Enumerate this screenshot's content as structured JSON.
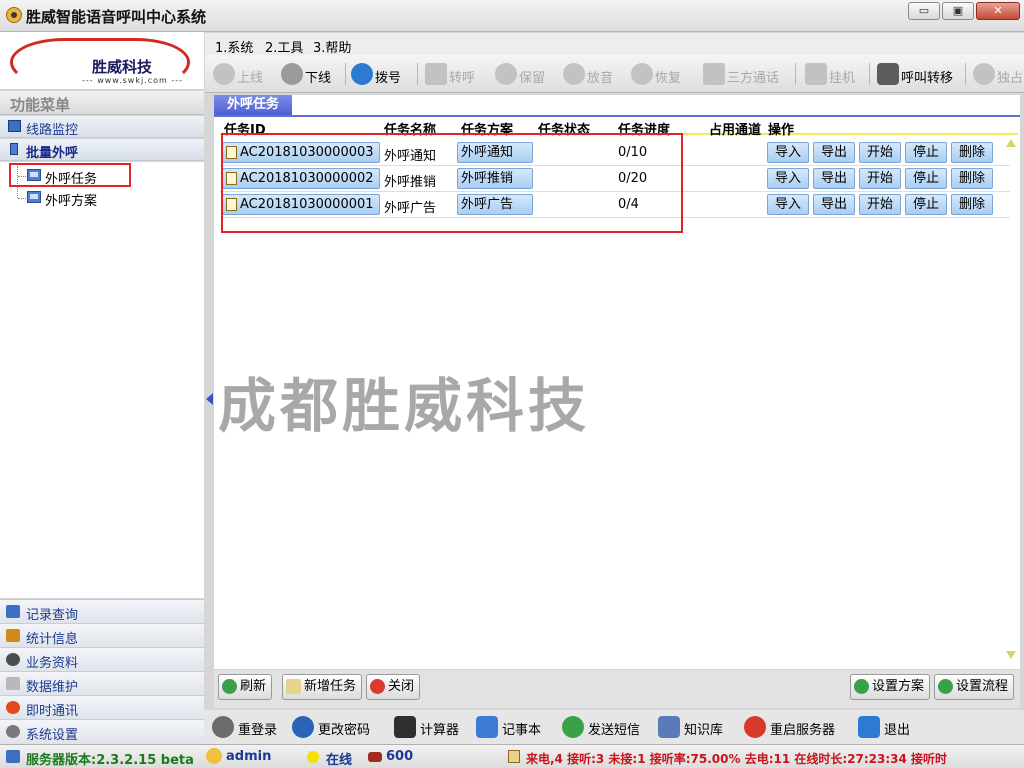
{
  "window": {
    "title": "胜威智能语音呼叫中心系统",
    "minimize": "▭",
    "restore": "▣",
    "close": "✕"
  },
  "logo": {
    "name": "胜威科技",
    "url": "--- www.swkj.com ---"
  },
  "menu": {
    "items": [
      "1.系统",
      "2.工具",
      "3.帮助"
    ]
  },
  "toolbar": {
    "items": [
      {
        "label": "上线",
        "icon": "user-icon",
        "enabled": false
      },
      {
        "label": "下线",
        "icon": "user-icon",
        "enabled": true
      },
      {
        "label": "拨号",
        "icon": "phone-icon",
        "enabled": true
      },
      {
        "label": "转呼",
        "icon": "transfer-icon",
        "enabled": false
      },
      {
        "label": "保留",
        "icon": "hold-icon",
        "enabled": false
      },
      {
        "label": "放音",
        "icon": "play-icon",
        "enabled": false
      },
      {
        "label": "恢复",
        "icon": "resume-icon",
        "enabled": false
      },
      {
        "label": "三方通话",
        "icon": "conference-icon",
        "enabled": false
      },
      {
        "label": "挂机",
        "icon": "hangup-icon",
        "enabled": false
      },
      {
        "label": "呼叫转移",
        "icon": "forward-icon",
        "enabled": true
      },
      {
        "label": "独占",
        "icon": "exclusive-icon",
        "enabled": false
      }
    ]
  },
  "sidebar": {
    "header": "功能菜单",
    "top_items": [
      {
        "label": "线路监控",
        "icon": "monitor-icon"
      },
      {
        "label": "批量外呼",
        "icon": "batch-call-icon"
      }
    ],
    "tree": [
      {
        "label": "外呼任务"
      },
      {
        "label": "外呼方案"
      }
    ],
    "bottom_items": [
      {
        "label": "记录查询",
        "icon": "records-icon",
        "color": "#3a6fc4"
      },
      {
        "label": "统计信息",
        "icon": "stats-icon",
        "color": "#d08a18"
      },
      {
        "label": "业务资料",
        "icon": "business-icon",
        "color": "#4c4c4c"
      },
      {
        "label": "数据维护",
        "icon": "data-icon",
        "color": "#8a8a8a"
      },
      {
        "label": "即时通讯",
        "icon": "im-icon",
        "color": "#e04b1b"
      },
      {
        "label": "系统设置",
        "icon": "settings-icon",
        "color": "#7a7a7a"
      }
    ]
  },
  "tab": {
    "label": "外呼任务"
  },
  "table": {
    "headers": [
      "任务ID",
      "任务名称",
      "任务方案",
      "任务状态",
      "任务进度",
      "占用通道",
      "操作"
    ],
    "rows": [
      {
        "id": "AC20181030000003",
        "name": "外呼通知",
        "plan": "外呼通知",
        "status": "",
        "progress": "0/10",
        "channels": ""
      },
      {
        "id": "AC20181030000002",
        "name": "外呼推销",
        "plan": "外呼推销",
        "status": "",
        "progress": "0/20",
        "channels": ""
      },
      {
        "id": "AC20181030000001",
        "name": "外呼广告",
        "plan": "外呼广告",
        "status": "",
        "progress": "0/4",
        "channels": ""
      }
    ],
    "row_actions": [
      "导入",
      "导出",
      "开始",
      "停止",
      "删除"
    ]
  },
  "watermark": "成都胜威科技",
  "actions": {
    "refresh": "刷新",
    "new_task": "新增任务",
    "close": "关闭",
    "set_plan": "设置方案",
    "set_flow": "设置流程"
  },
  "tools": [
    {
      "label": "重登录",
      "icon": "relogin-icon",
      "color": "#6b6b6b"
    },
    {
      "label": "更改密码",
      "icon": "password-icon",
      "color": "#2a63b8"
    },
    {
      "label": "计算器",
      "icon": "calculator-icon",
      "color": "#2f2f2f"
    },
    {
      "label": "记事本",
      "icon": "notepad-icon",
      "color": "#3d7bd4"
    },
    {
      "label": "发送短信",
      "icon": "sms-icon",
      "color": "#3aa04a"
    },
    {
      "label": "知识库",
      "icon": "knowledge-icon",
      "color": "#5a7bb8"
    },
    {
      "label": "重启服务器",
      "icon": "restart-icon",
      "color": "#d8392a"
    },
    {
      "label": "退出",
      "icon": "exit-icon",
      "color": "#2d7ad2"
    }
  ],
  "status": {
    "version": "服务器版本:2.3.2.15 beta",
    "user": "admin",
    "online": "在线",
    "extension": "600",
    "stats": "来电,4 接听:3 未接:1 接听率:75.00% 去电:11 在线时长:27:23:34 接听时"
  },
  "colors": {
    "accent": "#5f6fd8",
    "highlight": "#e0242a",
    "status_blue": "#1c3a92",
    "status_red": "#c8141b"
  }
}
